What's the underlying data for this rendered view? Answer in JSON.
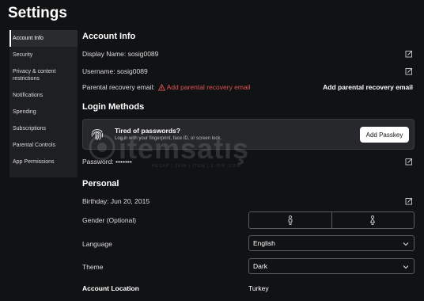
{
  "page": {
    "title": "Settings"
  },
  "sidebar": {
    "items": [
      {
        "label": "Account Info",
        "active": true
      },
      {
        "label": "Security"
      },
      {
        "label": "Privacy & content restrictions"
      },
      {
        "label": "Notifications"
      },
      {
        "label": "Spending"
      },
      {
        "label": "Subscriptions"
      },
      {
        "label": "Parental Controls"
      },
      {
        "label": "App Permissions"
      }
    ]
  },
  "account_info": {
    "title": "Account Info",
    "display_name": "Display Name: sosig0089",
    "username": "Username: sosig0089",
    "parental_recovery_label": "Parental recovery email:",
    "parental_recovery_link": "Add parental recovery email",
    "parental_recovery_action": "Add parental recovery email"
  },
  "login_methods": {
    "title": "Login Methods",
    "passkey_title": "Tired of passwords?",
    "passkey_desc": "Log in with your fingerprint, face ID, or screen lock.",
    "add_passkey": "Add Passkey",
    "password": "Password: •••••••"
  },
  "personal": {
    "title": "Personal",
    "birthday": "Birthday: Jun 20, 2015",
    "gender_label": "Gender (Optional)",
    "language_label": "Language",
    "language_value": "English",
    "theme_label": "Theme",
    "theme_value": "Dark",
    "location_label": "Account Location",
    "location_value": "Turkey"
  },
  "watermark": {
    "text": "itemsatış",
    "sub": "HESAP | SKIN | ITEM | E-PIN .COM"
  },
  "colors": {
    "background": "#111214",
    "sidebar": "#1e1f22",
    "warning": "#e05252",
    "card": "#27282b"
  },
  "icons": [
    "edit-icon",
    "warning-icon",
    "fingerprint-icon",
    "male-icon",
    "female-icon",
    "chevron-down-icon"
  ]
}
